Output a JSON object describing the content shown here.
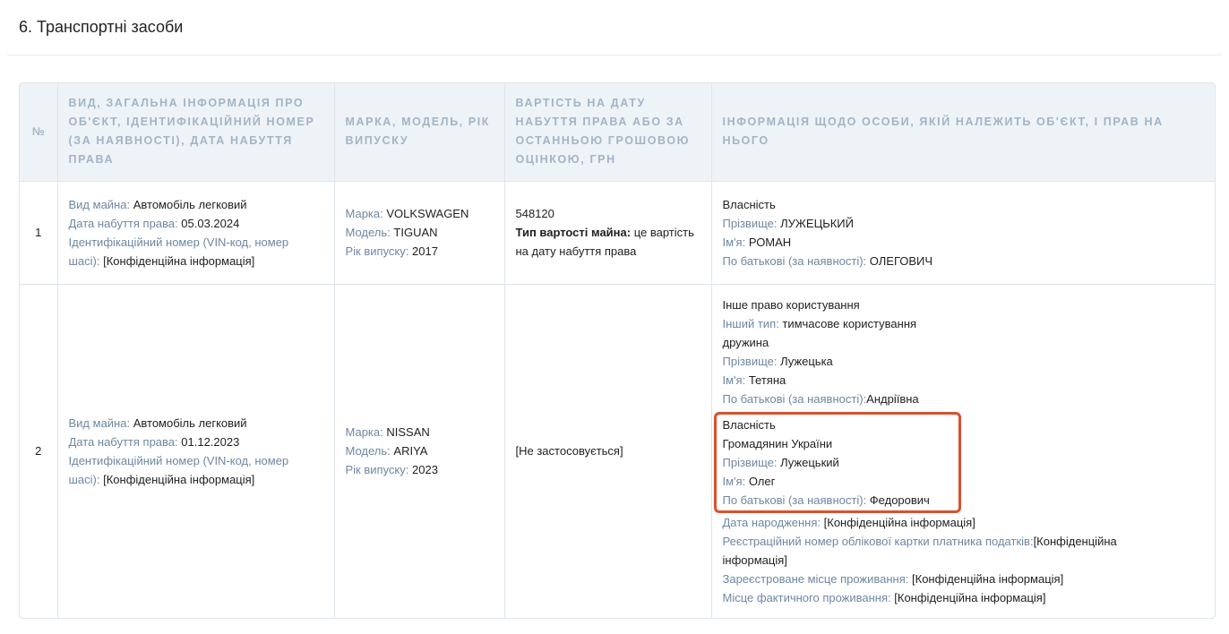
{
  "section_title": "6. Транспортні засоби",
  "columns": {
    "num": "№",
    "description": "ВИД, ЗАГАЛЬНА ІНФОРМАЦІЯ ПРО ОБ'ЄКТ, ІДЕНТИФІКАЦІЙНИЙ НОМЕР (ЗА НАЯВНОСТІ), ДАТА НАБУТТЯ ПРАВА",
    "brand": "МАРКА, МОДЕЛЬ, РІК ВИПУСКУ",
    "value": "ВАРТІСТЬ НА ДАТУ НАБУТТЯ ПРАВА АБО ЗА ОСТАННЬОЮ ГРОШОВОЮ ОЦІНКОЮ, ГРН",
    "owner": "ІНФОРМАЦІЯ ЩОДО ОСОБИ, ЯКІЙ НАЛЕЖИТЬ ОБ'ЄКТ, І ПРАВ НА НЬОГО"
  },
  "labels": {
    "kind": "Вид майна:",
    "date": "Дата набуття права:",
    "vin": "Ідентифікаційний номер (VIN-код, номер шасі):",
    "brand": "Марка:",
    "model": "Модель:",
    "year": "Рік випуску:",
    "value_type": "Тип вартості майна:",
    "surname": "Прізвище:",
    "name": "Ім'я:",
    "patronymic": "По батькові (за наявності):",
    "other_type": "Інший тип:",
    "birth_date": "Дата народження:",
    "tax_number": "Реєстраційний номер облікової картки платника податків:",
    "reg_address": "Зареєстроване місце проживання:",
    "actual_address": "Місце фактичного проживання:"
  },
  "rows": [
    {
      "num": "1",
      "kind": "Автомобіль легковий",
      "date": "05.03.2024",
      "vin": "[Конфіденційна інформація]",
      "brand": "VOLKSWAGEN",
      "model": "TIGUAN",
      "year": "2017",
      "value": "548120",
      "value_type": "це вартість на дату набуття права",
      "owner": {
        "right": "Власність",
        "surname": "ЛУЖЕЦЬКИЙ",
        "name": "РОМАН",
        "patronymic": "ОЛЕГОВИЧ"
      }
    },
    {
      "num": "2",
      "kind": "Автомобіль легковий",
      "date": "01.12.2023",
      "vin": "[Конфіденційна інформація]",
      "brand": "NISSAN",
      "model": "ARIYA",
      "year": "2023",
      "value": "[Не застосовується]",
      "owner_a": {
        "right": "Інше право користування",
        "other_type": "тимчасове користування",
        "relation": "дружина",
        "surname": "Лужецька",
        "name": "Тетяна",
        "patronymic": "Андріївна"
      },
      "owner_b": {
        "right": "Власність",
        "citizenship": "Громадянин України",
        "surname": "Лужецький",
        "name": "Олег",
        "patronymic": "Федорович",
        "birth_date": "[Конфіденційна інформація]",
        "tax_number_1": "[Конфіденційна",
        "tax_number_2": "інформація]",
        "reg_address": "[Конфіденційна інформація]",
        "actual_address": "[Конфіденційна інформація]"
      }
    }
  ]
}
